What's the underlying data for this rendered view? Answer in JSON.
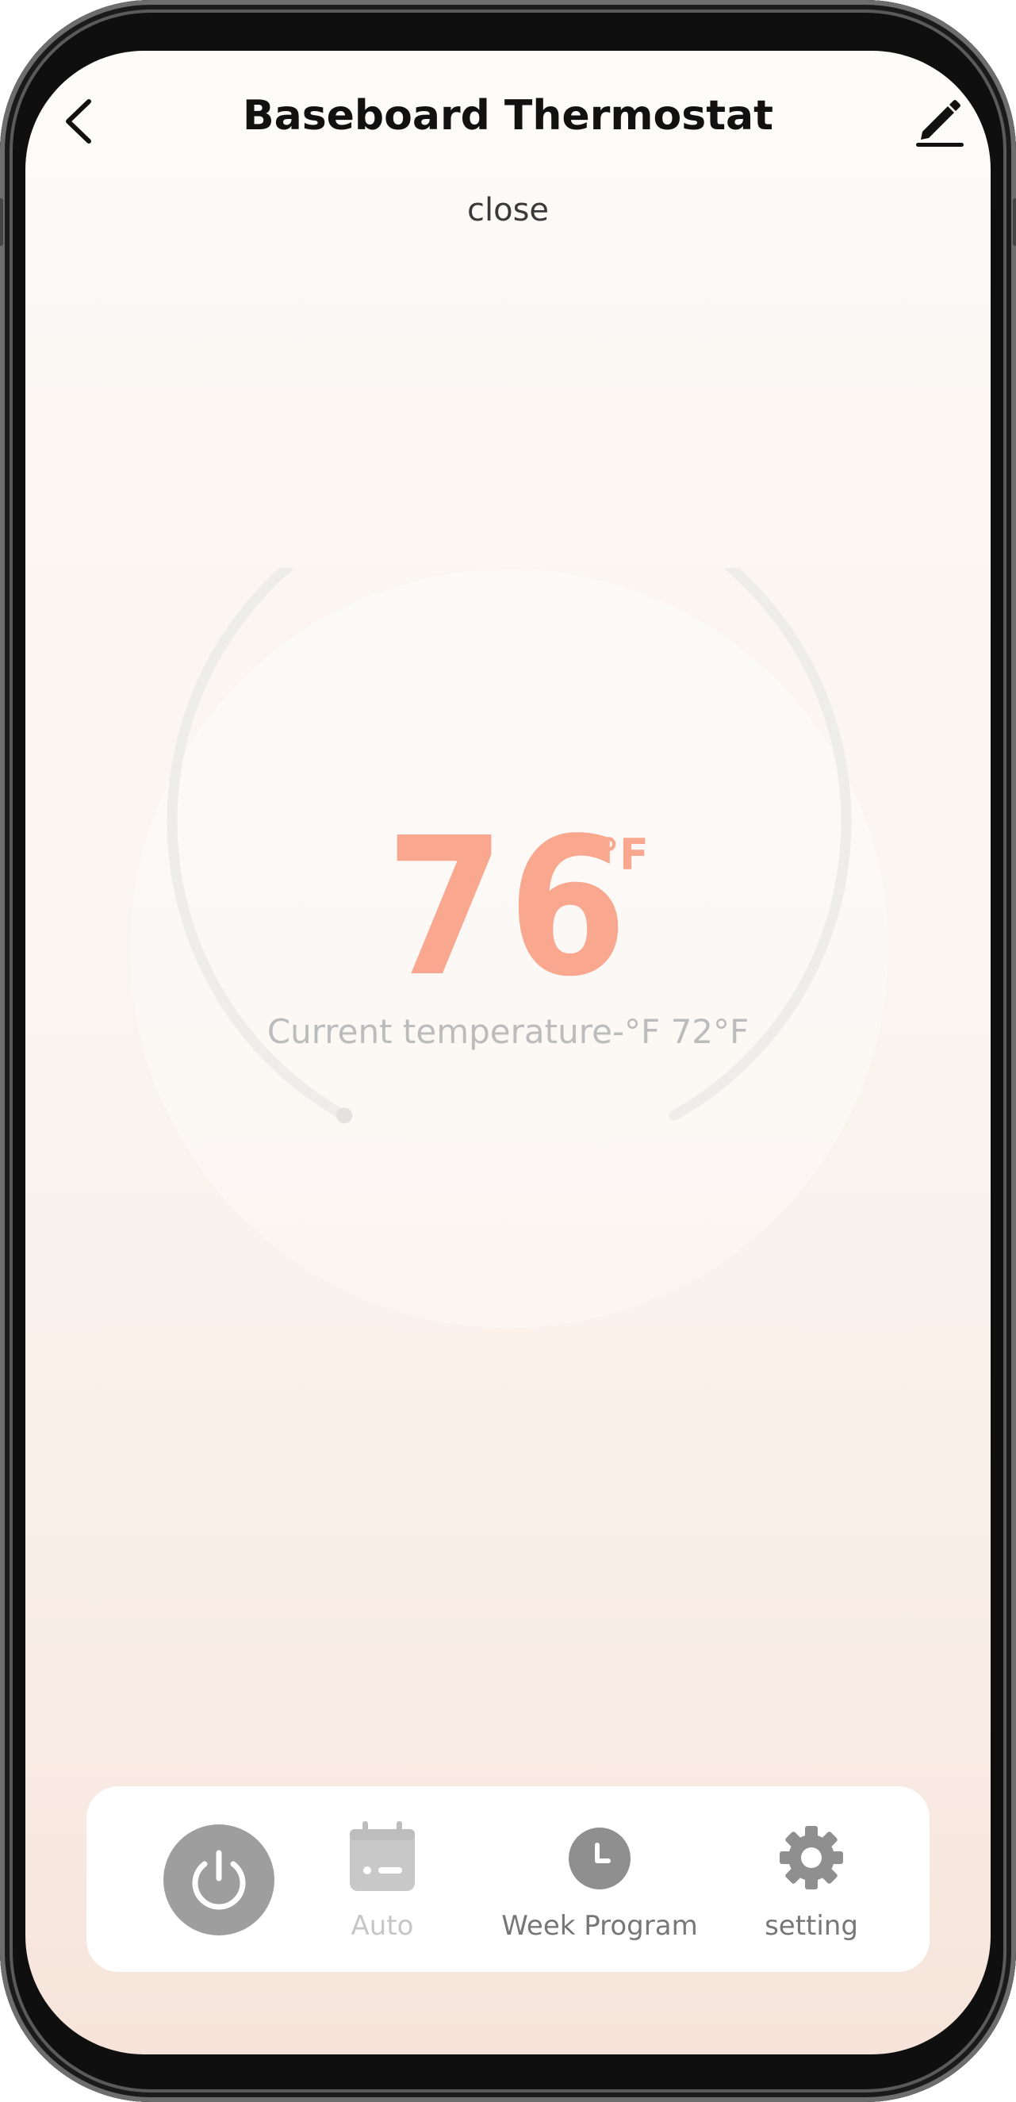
{
  "header": {
    "title": "Baseboard Thermostat",
    "status": "close"
  },
  "thermostat": {
    "set_temp": "76",
    "unit": "°F",
    "current_temp_label": "Current temperature-°F 72°F"
  },
  "bottom_bar": {
    "tabs": [
      {
        "label": "",
        "icon": "power-icon"
      },
      {
        "label": "Auto",
        "icon": "calendar-icon"
      },
      {
        "label": "Week Program",
        "icon": "clock-icon"
      },
      {
        "label": "setting",
        "icon": "gear-icon"
      }
    ]
  },
  "colors": {
    "accent": "#f9a88f",
    "icon_gray": "#8f8f8f",
    "disabled_gray": "#c6c6c6"
  }
}
